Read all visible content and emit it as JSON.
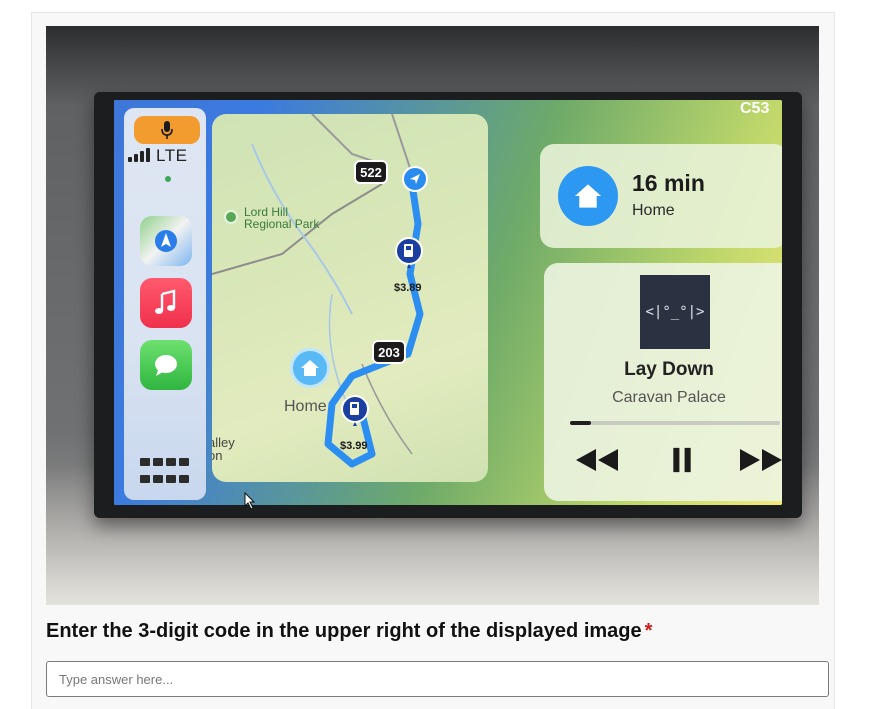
{
  "image": {
    "carplay": {
      "status": {
        "network": "LTE"
      },
      "dock": {
        "apps": [
          {
            "name": "Maps",
            "icon": "maps-icon"
          },
          {
            "name": "Music",
            "icon": "music-note-icon"
          },
          {
            "name": "Messages",
            "icon": "message-bubble-icon"
          }
        ],
        "mic_icon": "microphone-icon",
        "app_grid_icon": "app-grid-icon"
      },
      "map": {
        "park_label_line1": "Lord Hill",
        "park_label_line2": "Regional Park",
        "route_shields": [
          "522",
          "203"
        ],
        "gas_prices": [
          "$3.89",
          "$3.99"
        ],
        "home_label": "Home",
        "partial_label_line1": "alley",
        "partial_label_line2": "on"
      },
      "eta": {
        "time": "16 min",
        "destination": "Home"
      },
      "now_playing": {
        "title": "Lay Down",
        "artist": "Caravan Palace",
        "album_art_text": "<|°_°|>",
        "progress": 0.1
      },
      "corner_code": "C53"
    }
  },
  "form": {
    "question": "Enter the 3-digit code in the upper right of the displayed image",
    "required_marker": "*",
    "answer_placeholder": "Type answer here...",
    "answer_value": ""
  },
  "colors": {
    "accent_blue": "#2c98f2",
    "required_red": "#d21c1c",
    "mic_orange": "#f29b2e"
  }
}
